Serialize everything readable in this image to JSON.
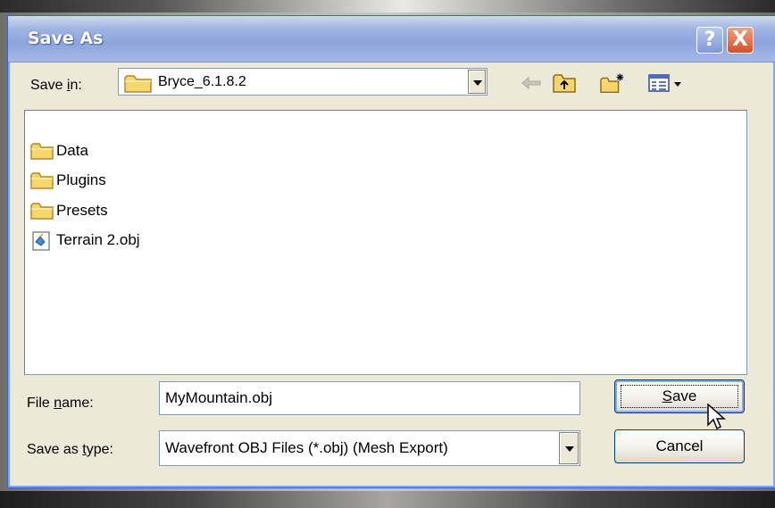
{
  "dialog": {
    "title": "Save As",
    "help_label": "?",
    "close_label": "X"
  },
  "location": {
    "label_pre": "Save ",
    "label_accel": "i",
    "label_post": "n:",
    "current": "Bryce_6.1.8.2"
  },
  "toolbar": {
    "back": "back-arrow-icon",
    "up": "up-one-level-icon",
    "new_folder": "new-folder-icon",
    "views": "view-menu-icon"
  },
  "files": [
    {
      "name": "Data",
      "type": "folder",
      "icon": "folder-icon"
    },
    {
      "name": "Plugins",
      "type": "folder",
      "icon": "folder-icon"
    },
    {
      "name": "Presets",
      "type": "folder",
      "icon": "folder-icon"
    },
    {
      "name": "Terrain 2.obj",
      "type": "file",
      "icon": "obj-file-icon"
    }
  ],
  "filename": {
    "label_pre": "File ",
    "label_accel": "n",
    "label_post": "ame:",
    "value": "MyMountain.obj"
  },
  "filetype": {
    "label_pre": "Save as ",
    "label_accel": "t",
    "label_post": "ype:",
    "selected": "Wavefront OBJ Files (*.obj) (Mesh Export)"
  },
  "buttons": {
    "save_accel": "S",
    "save_rest": "ave",
    "cancel": "Cancel"
  },
  "colors": {
    "title_bar": "#9fb3e2",
    "dialog_bg": "#ece9d8",
    "close_red": "#d84f26",
    "folder_yellow": "#f7d66b"
  }
}
